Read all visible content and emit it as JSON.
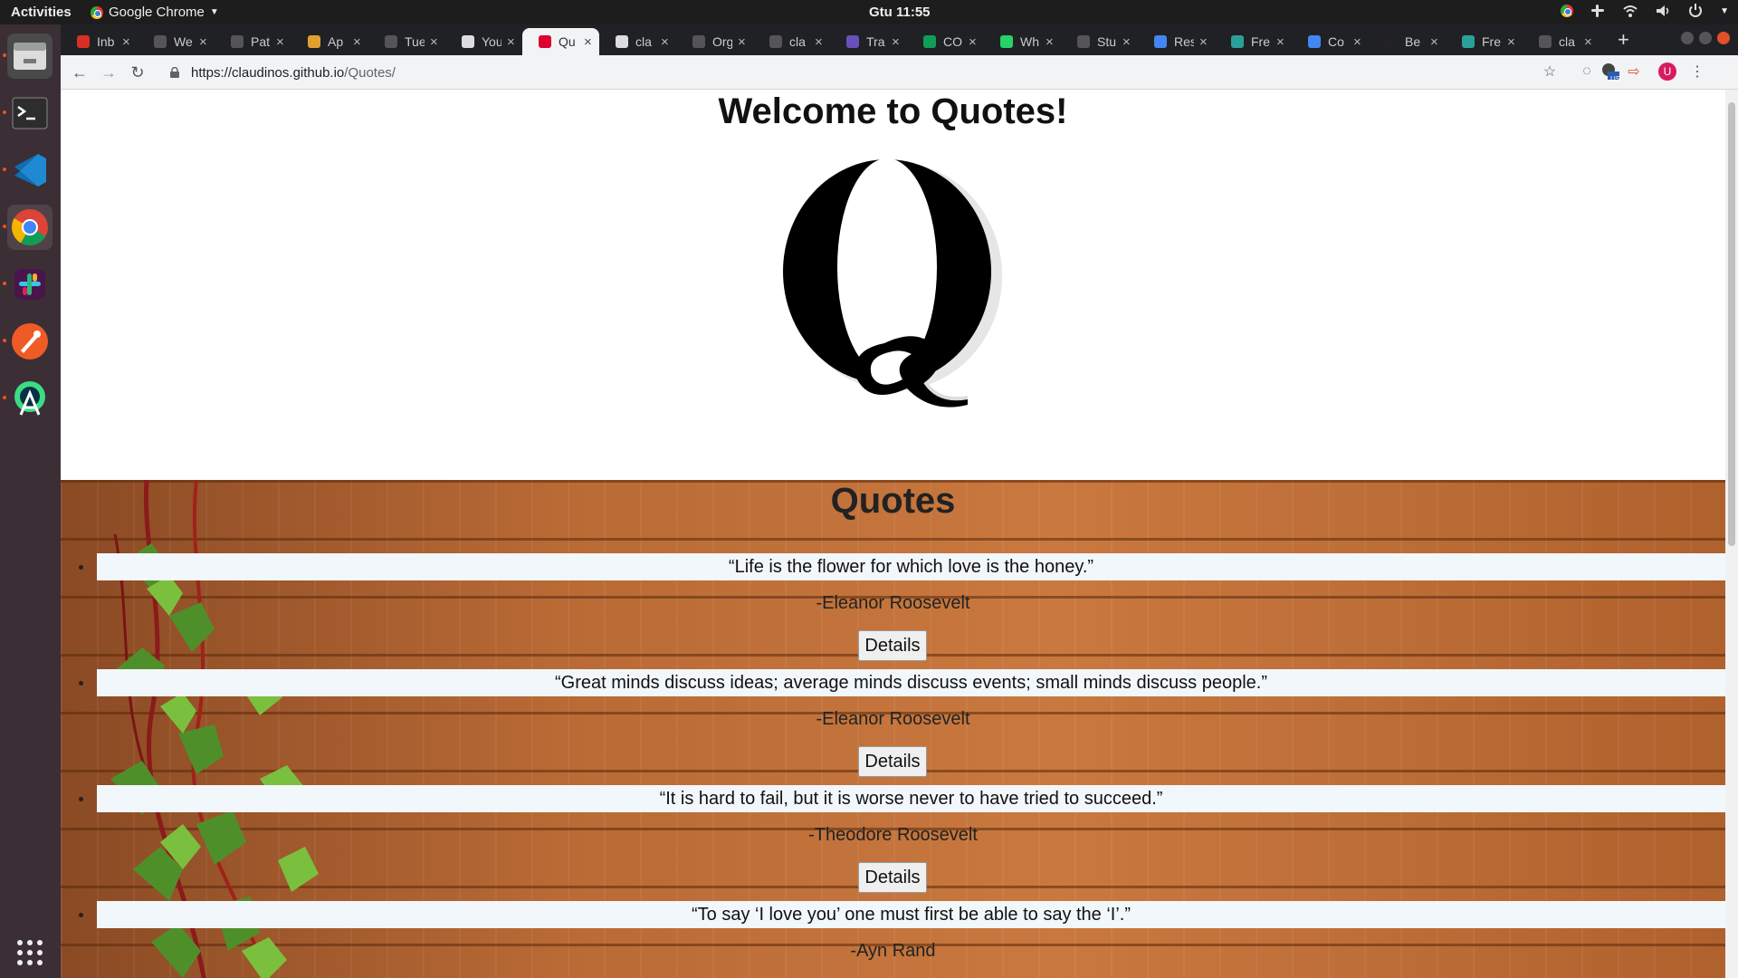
{
  "system": {
    "activities_label": "Activities",
    "app_menu_label": "Google Chrome",
    "clock": "Gtu 11:55"
  },
  "browser": {
    "tabs": [
      {
        "title": "Inb",
        "favicon_color": "#d93025"
      },
      {
        "title": "We",
        "favicon_color": "#555555"
      },
      {
        "title": "Pat",
        "favicon_color": "#555555"
      },
      {
        "title": "Ap",
        "favicon_color": "#e0a030"
      },
      {
        "title": "Tue",
        "favicon_color": "#555555"
      },
      {
        "title": "You",
        "favicon_color": "#dddddd"
      },
      {
        "title": "Qu",
        "favicon_color": "#dd0031",
        "active": true
      },
      {
        "title": "cla",
        "favicon_color": "#dddddd"
      },
      {
        "title": "Org",
        "favicon_color": "#555555"
      },
      {
        "title": "cla",
        "favicon_color": "#555555"
      },
      {
        "title": "Tra",
        "favicon_color": "#6b4fbb"
      },
      {
        "title": "CO",
        "favicon_color": "#0f9d58"
      },
      {
        "title": "Wh",
        "favicon_color": "#25d366"
      },
      {
        "title": "Stu",
        "favicon_color": "#555555"
      },
      {
        "title": "Res",
        "favicon_color": "#4285f4"
      },
      {
        "title": "Fre",
        "favicon_color": "#2aa198"
      },
      {
        "title": "Co",
        "favicon_color": "#4285f4"
      },
      {
        "title": "Be",
        "favicon_color": "#222222"
      },
      {
        "title": "Fre",
        "favicon_color": "#2aa198"
      },
      {
        "title": "cla",
        "favicon_color": "#555555"
      }
    ],
    "close_glyph": "×",
    "new_tab_glyph": "+",
    "url_host": "https://claudinos.github.io",
    "url_path": "/Quotes/",
    "profile_initial": "U",
    "extension_badge": "US"
  },
  "page": {
    "title": "Welcome to Quotes!",
    "logo_letter": "Q",
    "section_title": "Quotes",
    "details_label": "Details",
    "quotes": [
      {
        "text": "“Life is the flower for which love is the honey.”",
        "author": "-Eleanor Roosevelt"
      },
      {
        "text": "“Great minds discuss ideas; average minds discuss events; small minds discuss people.”",
        "author": "-Eleanor Roosevelt"
      },
      {
        "text": "“It is hard to fail, but it is worse never to have tried to succeed.”",
        "author": "-Theodore Roosevelt"
      },
      {
        "text": "“To say ‘I love you’ one must first be able to say the ‘I’.”",
        "author": "-Ayn Rand"
      }
    ]
  },
  "colors": {
    "dock_bg": "#3b2e35",
    "tabstrip_bg": "#1f2125",
    "quote_strip_bg": "#f2f7fb",
    "wood": "#b96a35"
  },
  "icons": {
    "dock": [
      "files-icon",
      "terminal-icon",
      "vscode-icon",
      "chrome-icon",
      "slack-icon",
      "postman-icon",
      "android-studio-icon",
      "show-apps-icon"
    ]
  }
}
